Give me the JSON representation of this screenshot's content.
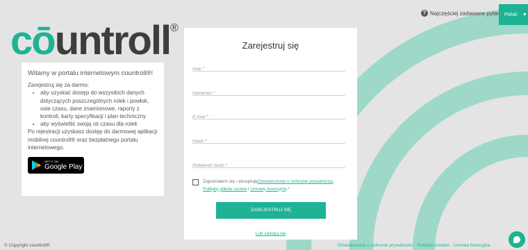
{
  "topbar": {
    "faq_label": "Najczęściej zadawane pytania",
    "faq_icon": "question-circle-icon",
    "language": "Polski"
  },
  "logo": {
    "text_part1": "cō",
    "text_part2": "untroll",
    "registered": "®",
    "color_teal": "#1db394",
    "color_dark": "#3d3d3d"
  },
  "info": {
    "heading": "Witamy w portalu internetowym countroll®!",
    "intro": "Zarejestruj się za darmo:",
    "bullets": [
      "aby uzyskać dostęp do wszystkich danych dotyczących poszczególnych rolek i powłok, osie czasu, dane znamionowe, raporty z kontroli, karty specyfikacji i plan techniczny",
      "aby wyświetlić swoją oś czasu dla rolek"
    ],
    "outro": "Po rejestracji uzyskasz dostęp do darmowej aplikacji mobilnej countroll® oraz bezpłatnego portalu internetowego.",
    "store_small": "GET IT ON",
    "store_big": "Google Play"
  },
  "form": {
    "title": "Zarejestruj się",
    "fields": {
      "first_name": "Imię *",
      "last_name": "Nazwisko *",
      "email": "E-mail *",
      "password": "Hasło *",
      "password_confirm": "Potwierdź hasło *"
    },
    "consent_prefix": "Zapoznałem się i akceptuję",
    "consent_privacy": "Oświadczenie o ochronie prywatności",
    "consent_sep1": ", ",
    "consent_cookies": "Politykę plików cookie",
    "consent_sep2": " i ",
    "consent_license": "Umowę licencyjną",
    "consent_suffix": " *",
    "submit": "ZAREJESTRUJ SIĘ",
    "login": "Lub zaloguj się"
  },
  "footer": {
    "copyright": "© Copyright countroll®",
    "links": "Oświadczenie o ochronie prywatności · Polityka cookies · Umowa licencyjna"
  },
  "colors": {
    "accent": "#1db394",
    "background": "#e4e4e4",
    "arcs": "#9ed8c8"
  }
}
